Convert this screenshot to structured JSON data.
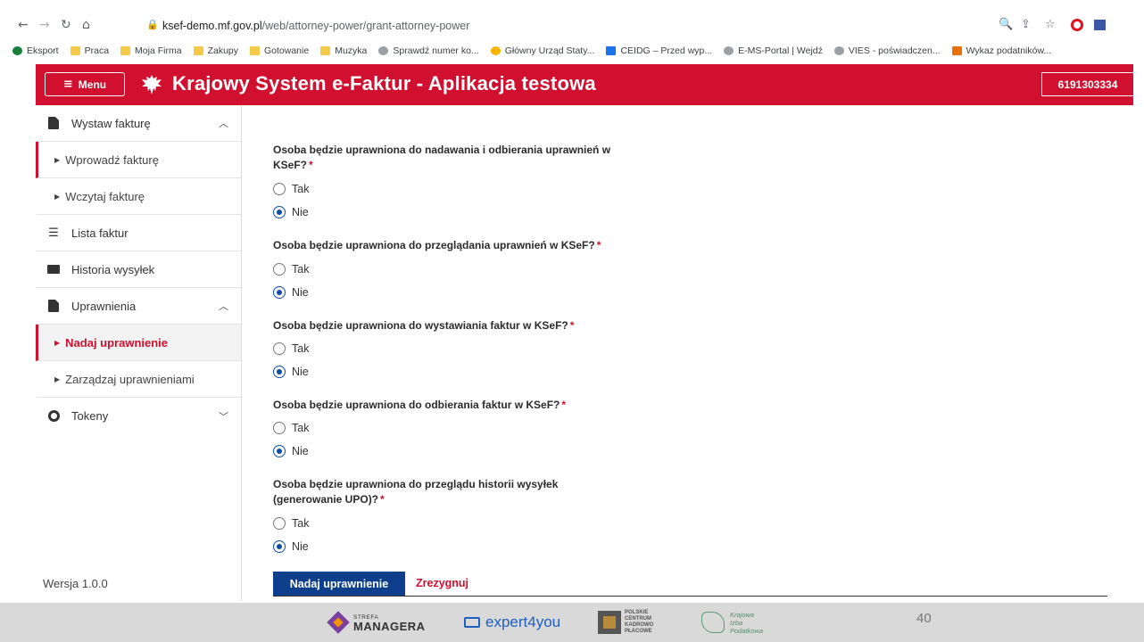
{
  "browser": {
    "url_host": "ksef-demo.mf.gov.pl",
    "url_path": "/web/attorney-power/grant-attorney-power",
    "bookmarks": [
      {
        "label": "Eksport",
        "icon": "green-globe-icon"
      },
      {
        "label": "Praca",
        "icon": "folder-icon"
      },
      {
        "label": "Moja Firma",
        "icon": "folder-icon"
      },
      {
        "label": "Zakupy",
        "icon": "folder-icon"
      },
      {
        "label": "Gotowanie",
        "icon": "folder-icon"
      },
      {
        "label": "Muzyka",
        "icon": "folder-icon"
      },
      {
        "label": "Sprawdź numer ko...",
        "icon": "globe-icon"
      },
      {
        "label": "Główny Urząd Staty...",
        "icon": "gus-icon"
      },
      {
        "label": "CEIDG – Przed wyp...",
        "icon": "ceidg-icon"
      },
      {
        "label": "E-MS-Portal | Wejdź",
        "icon": "eagle-icon"
      },
      {
        "label": "VIES - poświadczen...",
        "icon": "globe-icon"
      },
      {
        "label": "Wykaz podatników...",
        "icon": "chart-icon"
      }
    ]
  },
  "header": {
    "menu_label": "Menu",
    "title": "Krajowy System e-Faktur - Aplikacja testowa",
    "nip": "6191303334"
  },
  "sidebar": {
    "items": [
      {
        "label": "Wystaw fakturę"
      },
      {
        "label": "Wprowadź fakturę"
      },
      {
        "label": "Wczytaj fakturę"
      },
      {
        "label": "Lista faktur"
      },
      {
        "label": "Historia wysyłek"
      },
      {
        "label": "Uprawnienia"
      },
      {
        "label": "Nadaj uprawnienie"
      },
      {
        "label": "Zarządzaj uprawnieniami"
      },
      {
        "label": "Tokeny"
      }
    ],
    "version": "Wersja 1.0.0"
  },
  "form": {
    "required_mark": "*",
    "yes_label": "Tak",
    "no_label": "Nie",
    "questions": [
      {
        "line1": "Osoba będzie uprawniona do nadawania i odbierania uprawnień w",
        "line2": "KSeF?",
        "selected": "Nie"
      },
      {
        "line1": "Osoba będzie uprawniona do przeglądania uprawnień w KSeF?",
        "line2": "",
        "selected": "Nie"
      },
      {
        "line1": "Osoba będzie uprawniona do wystawiania faktur w KSeF?",
        "line2": "",
        "selected": "Nie"
      },
      {
        "line1": "Osoba będzie uprawniona do odbierania faktur w KSeF?",
        "line2": "",
        "selected": "Nie"
      },
      {
        "line1": "Osoba będzie uprawniona do przeglądu historii wysyłek",
        "line2": "(generowanie UPO)?",
        "selected": "Nie"
      }
    ],
    "submit_label": "Nadaj uprawnienie",
    "cancel_label": "Zrezygnuj"
  },
  "footer": {
    "logo1_small": "STREFA",
    "logo1_big": "MANAGERA",
    "logo2": "expert4you",
    "logo3": [
      "POLSKIE",
      "CENTRUM",
      "KADROWO",
      "PŁACOWE"
    ],
    "logo4": [
      "Krajowa",
      "Izba",
      "Podatkowa"
    ],
    "page_number": "40"
  },
  "colors": {
    "brand_red": "#d0102e",
    "primary_blue": "#0e3f8c"
  }
}
